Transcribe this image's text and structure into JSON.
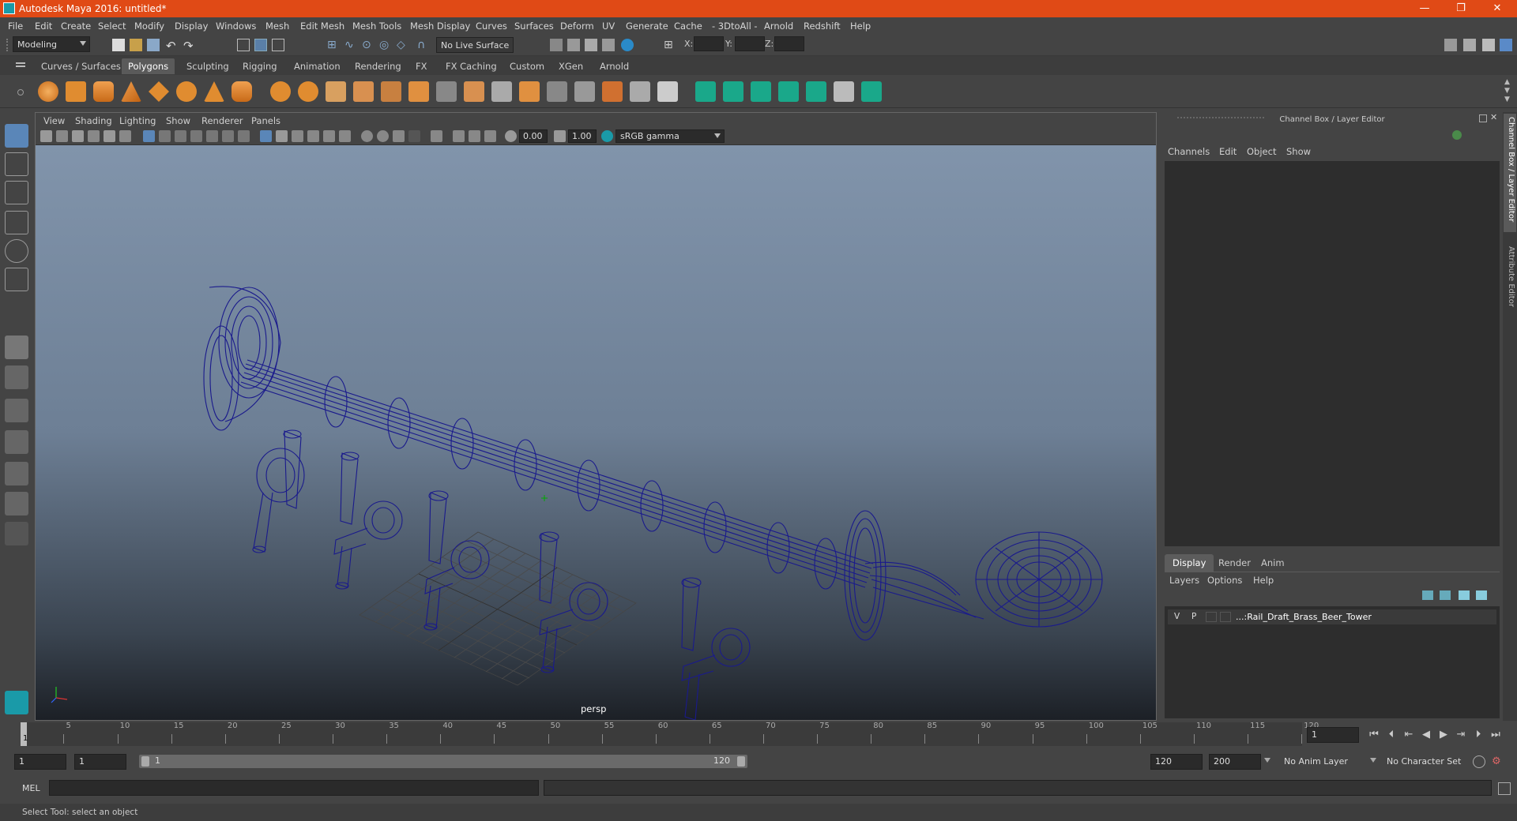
{
  "window": {
    "title": "Autodesk Maya 2016: untitled*",
    "controls": [
      "—",
      "❐",
      "✕"
    ]
  },
  "menubar": [
    "File",
    "Edit",
    "Create",
    "Select",
    "Modify",
    "Display",
    "Windows",
    "Mesh",
    "Edit Mesh",
    "Mesh Tools",
    "Mesh Display",
    "Curves",
    "Surfaces",
    "Deform",
    "UV",
    "Generate",
    "Cache",
    "- 3DtoAll -",
    "Arnold",
    "Redshift",
    "Help"
  ],
  "statusline": {
    "mode": "Modeling",
    "live_surface": "No Live Surface",
    "x_label": "X:",
    "y_label": "Y:",
    "z_label": "Z:"
  },
  "shelf_tabs": [
    {
      "label": "Curves / Surfaces",
      "active": false
    },
    {
      "label": "Polygons",
      "active": true
    },
    {
      "label": "Sculpting",
      "active": false
    },
    {
      "label": "Rigging",
      "active": false
    },
    {
      "label": "Animation",
      "active": false
    },
    {
      "label": "Rendering",
      "active": false
    },
    {
      "label": "FX",
      "active": false
    },
    {
      "label": "FX Caching",
      "active": false
    },
    {
      "label": "Custom",
      "active": false
    },
    {
      "label": "XGen",
      "active": false
    },
    {
      "label": "Arnold",
      "active": false
    }
  ],
  "viewport": {
    "menu": [
      "View",
      "Shading",
      "Lighting",
      "Show",
      "Renderer",
      "Panels"
    ],
    "exposure": "0.00",
    "gamma": "1.00",
    "color_space": "sRGB gamma",
    "camera_label": "persp",
    "wire_color": "#1a1a8c"
  },
  "channel_box": {
    "title": "Channel Box / Layer Editor",
    "menu": [
      "Channels",
      "Edit",
      "Object",
      "Show"
    ]
  },
  "layer_editor": {
    "tabs": [
      {
        "label": "Display",
        "active": true
      },
      {
        "label": "Render",
        "active": false
      },
      {
        "label": "Anim",
        "active": false
      }
    ],
    "menu": [
      "Layers",
      "Options",
      "Help"
    ],
    "layers": [
      {
        "v": "V",
        "p": "P",
        "name": "...:Rail_Draft_Brass_Beer_Tower"
      }
    ]
  },
  "side_tabs": [
    "Channel Box / Layer Editor",
    "Attribute Editor"
  ],
  "timeline": {
    "start_marker": "1",
    "tick_labels": [
      "5",
      "10",
      "15",
      "20",
      "25",
      "30",
      "35",
      "40",
      "45",
      "50",
      "55",
      "60",
      "65",
      "70",
      "75",
      "80",
      "85",
      "90",
      "95",
      "100",
      "105",
      "110",
      "115",
      "120"
    ],
    "current_frame": "1"
  },
  "range": {
    "start": "1",
    "playback_start": "1",
    "slider_start": "1",
    "slider_end": "120",
    "playback_end": "120",
    "end": "200",
    "anim_layer": "No Anim Layer",
    "character_set": "No Character Set"
  },
  "command_line": {
    "label": "MEL"
  },
  "help_line": "Select Tool: select an object"
}
